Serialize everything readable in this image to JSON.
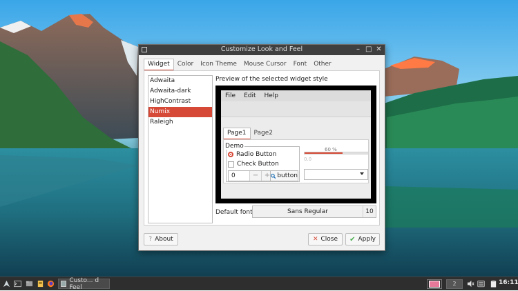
{
  "window": {
    "title": "Customize Look and Feel",
    "controls": [
      "–",
      "□",
      "✕"
    ]
  },
  "tabs": [
    {
      "label": "Widget",
      "active": true
    },
    {
      "label": "Color",
      "active": false
    },
    {
      "label": "Icon Theme",
      "active": false
    },
    {
      "label": "Mouse Cursor",
      "active": false
    },
    {
      "label": "Font",
      "active": false
    },
    {
      "label": "Other",
      "active": false
    }
  ],
  "themes": [
    {
      "label": "Adwaita",
      "selected": false
    },
    {
      "label": "Adwaita-dark",
      "selected": false
    },
    {
      "label": "HighContrast",
      "selected": false
    },
    {
      "label": "Numix",
      "selected": true
    },
    {
      "label": "Raleigh",
      "selected": false
    }
  ],
  "preview": {
    "label": "Preview of the selected widget style",
    "menus": [
      "File",
      "Edit",
      "Help"
    ],
    "tabs": [
      "Page1",
      "Page2"
    ],
    "demo_label": "Demo",
    "radio_label": "Radio Button",
    "check_label": "Check Button",
    "spin_value": "0",
    "spin_minus": "−",
    "spin_plus": "+",
    "button_label": "button",
    "progress_label": "60 %",
    "progress_fraction": 0.6,
    "slider_value": "0.0"
  },
  "font": {
    "label": "Default font:",
    "name": "Sans Regular",
    "size": "10"
  },
  "buttons": {
    "about": "About",
    "close": "Close",
    "apply": "Apply"
  },
  "taskbar": {
    "task_label": "Custo...  d Feel",
    "workspace_2": "2",
    "clock": "16:11"
  },
  "colors": {
    "accent": "#d64937",
    "titlebar": "#3f3f3f",
    "taskbar": "#2e2e2e"
  }
}
